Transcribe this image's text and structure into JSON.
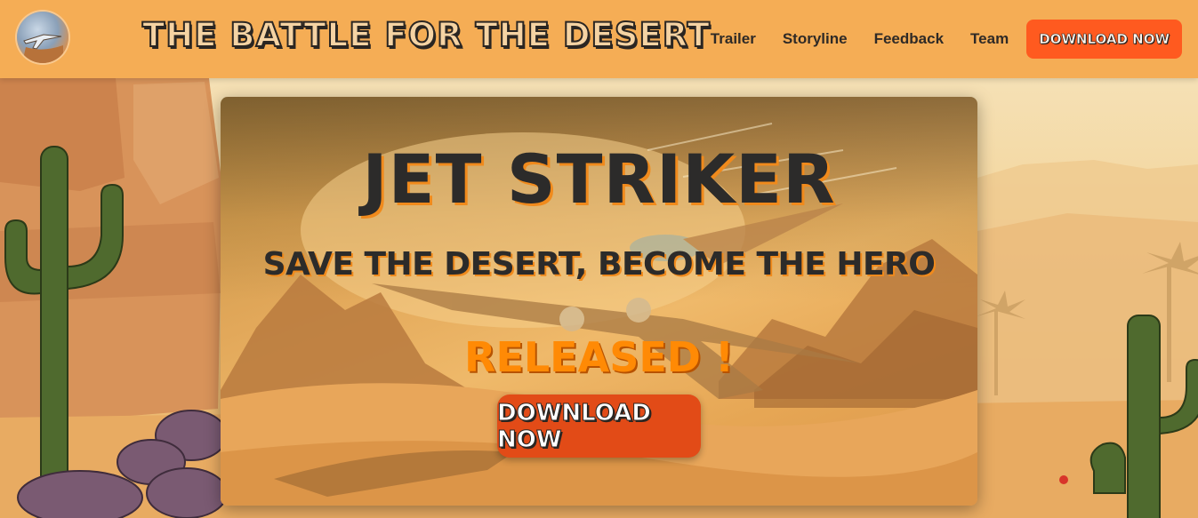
{
  "header": {
    "logo_icon": "jet-logo-icon",
    "site_title": "THE BATTLE FOR THE DESERT",
    "nav": [
      {
        "label": "Trailer"
      },
      {
        "label": "Storyline"
      },
      {
        "label": "Feedback"
      },
      {
        "label": "Team"
      }
    ],
    "download_label": "DOWNLOAD NOW"
  },
  "hero": {
    "title": "JET STRIKER",
    "subtitle": "SAVE THE DESERT, BECOME THE HERO",
    "status": "RELEASED !",
    "cta_label": "DOWNLOAD NOW"
  },
  "colors": {
    "header_bg": "#f5ad55",
    "accent_button": "#ff5a1f",
    "hero_button": "#e24b17",
    "released_text": "#ff8a05",
    "title_text": "#2c2b2a"
  }
}
